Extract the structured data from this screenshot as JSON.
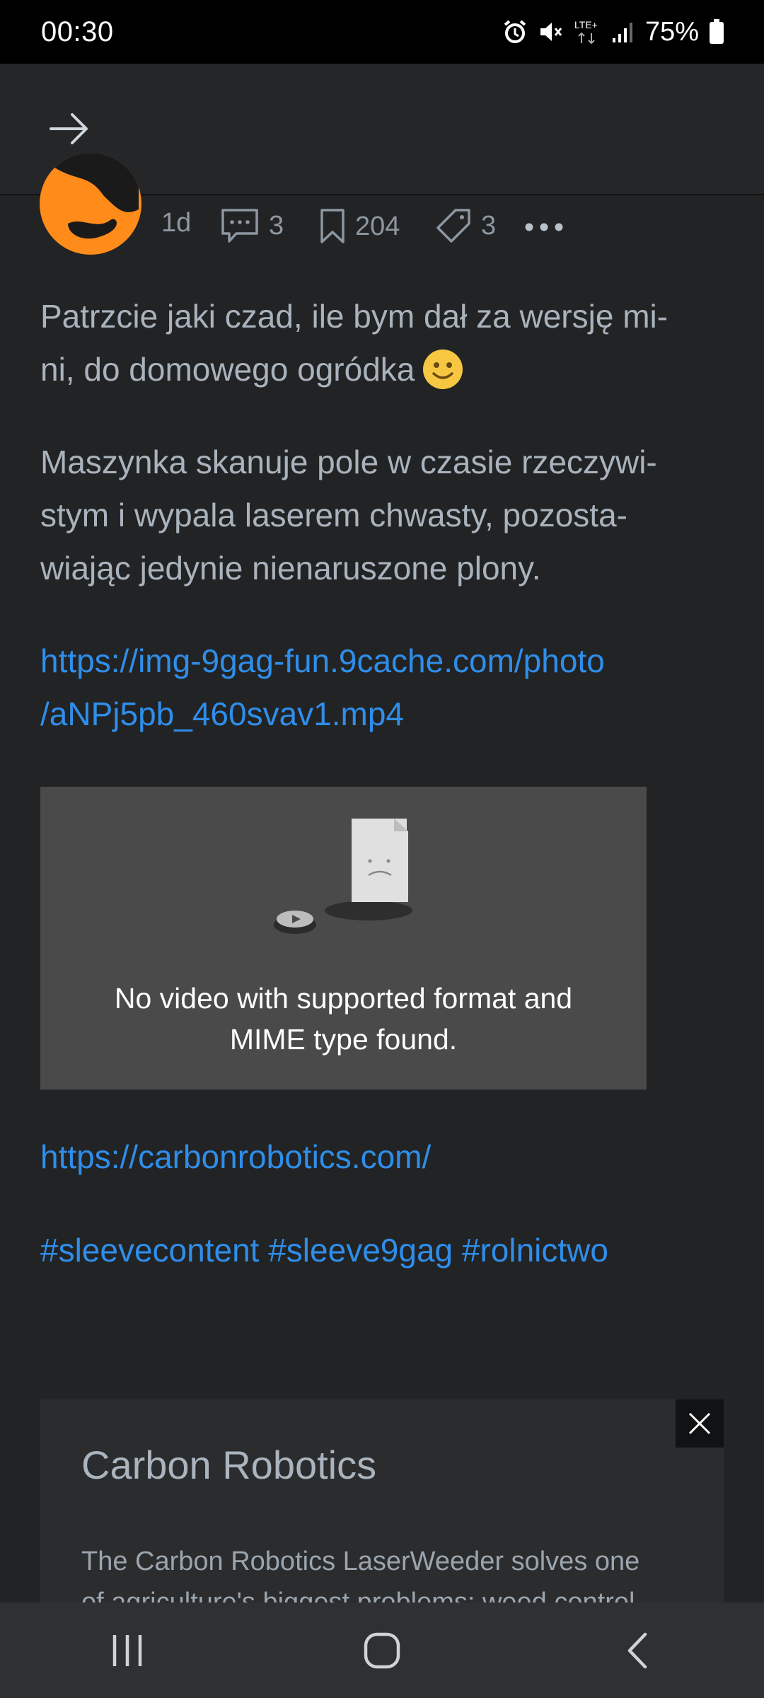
{
  "status_bar": {
    "time": "00:30",
    "network": "LTE+",
    "battery": "75%",
    "icons": [
      "alarm-icon",
      "mute-icon",
      "lte-icon",
      "signal-icon",
      "battery-icon"
    ]
  },
  "app_bar": {
    "icon": "arrow-right-icon"
  },
  "post_meta": {
    "age": "1d",
    "comments": "3",
    "bookmarks": "204",
    "tags": "3"
  },
  "post": {
    "paragraph1": "Patrzcie jaki czad, ile bym dał za wersję mi-ni, do domowego ogródka",
    "paragraph1_line1": "Patrzcie jaki czad, ile bym dał za wersję mi-",
    "paragraph1_line2": "ni, do domowego ogródka",
    "paragraph2_line1": "Maszynka skanuje pole w czasie rzeczywi-",
    "paragraph2_line2": "stym i wypala laserem chwasty, pozosta-",
    "paragraph2_line3": "wiając jedynie nienaruszone plony.",
    "video_link_line1": "https://img-9gag-fun.9cache.com/photo",
    "video_link_line2": "/aNPj5pb_460svav1.mp4",
    "video_error_line1": "No video with supported format and",
    "video_error_line2": "MIME type found.",
    "site_link": "https://carbonrobotics.com/",
    "hashtags": "#sleevecontent #sleeve9gag #rolnictwo"
  },
  "link_preview": {
    "title": "Carbon Robotics",
    "description_line1": "The Carbon Robotics LaserWeeder solves one",
    "description_line2": "of agriculture's biggest problems: weed control"
  },
  "colors": {
    "background": "#222324",
    "link": "#2f8eea",
    "text": "#a9b3bd",
    "avatar": "#ff8c1a"
  }
}
